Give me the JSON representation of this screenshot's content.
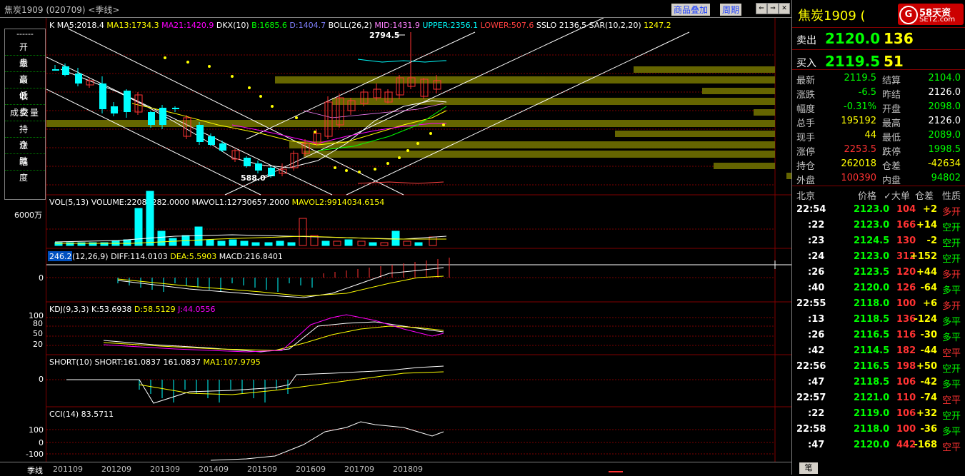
{
  "window": {
    "title": "焦炭1909 (020709) <季线>",
    "links": [
      "商品叠加",
      "周期"
    ],
    "period_label": "季线"
  },
  "leftpanel": {
    "dashes": "------",
    "items": [
      "开盘",
      "最高",
      "最低",
      "收盘",
      "成交量",
      "持仓",
      "涨跌",
      "幅度"
    ]
  },
  "colors": {
    "up": "#ff3232",
    "down": "#00ffff",
    "ma5": "#ffffff",
    "ma13": "#ffff00",
    "ma21": "#ff00ff",
    "grid": "#800000",
    "bid_green": "#00ff00",
    "vol_yellow": "#ffff00"
  },
  "main": {
    "indicator_line": [
      {
        "text": "K",
        "color": "#ffffff"
      },
      {
        "text": "MA5:2018.4",
        "color": "#ffffff"
      },
      {
        "text": "MA13:1734.3",
        "color": "#ffff00"
      },
      {
        "text": "MA21:1420.9",
        "color": "#ff00ff"
      },
      {
        "text": "DKX(10)",
        "color": "#ffffff"
      },
      {
        "text": "B:1685.6",
        "color": "#00ff00"
      },
      {
        "text": "D:1404.7",
        "color": "#8080ff"
      },
      {
        "text": "BOLL(26,2)",
        "color": "#ffffff"
      },
      {
        "text": "MID:1431.9",
        "color": "#ff80ff"
      },
      {
        "text": "UPPER:2356.1",
        "color": "#00ffff"
      },
      {
        "text": "LOWER:507.6",
        "color": "#ff4040"
      },
      {
        "text": "SSLO 2136.5",
        "color": "#ffffff"
      },
      {
        "text": "SAR(10,2,20)",
        "color": "#ffffff"
      },
      {
        "text": "1247.2",
        "color": "#ffff00"
      }
    ],
    "high_label": "2794.5",
    "low_label": "588.0"
  },
  "vol": {
    "indicator_line": [
      {
        "text": "VOL(5,13)",
        "color": "#ffffff"
      },
      {
        "text": "VOLUME:22084282.0000",
        "color": "#ffffff"
      },
      {
        "text": "MAVOL1:12730657.2000",
        "color": "#ffffff"
      },
      {
        "text": "MAVOL2:9914034.6154",
        "color": "#ffff00"
      }
    ],
    "axis_label": "6000万"
  },
  "macd": {
    "badge": "246.2",
    "indicator_line": [
      {
        "text": "(12,26,9)",
        "color": "#ffffff"
      },
      {
        "text": "DIFF:114.0103",
        "color": "#ffffff"
      },
      {
        "text": "DEA:5.5903",
        "color": "#ffff00"
      },
      {
        "text": "MACD:216.8401",
        "color": "#ffffff"
      }
    ],
    "zero_label": "0"
  },
  "kdj": {
    "indicator_line": [
      {
        "text": "KDJ(9,3,3)",
        "color": "#ffffff"
      },
      {
        "text": "K:53.6938",
        "color": "#ffffff"
      },
      {
        "text": "D:58.5129",
        "color": "#ffff00"
      },
      {
        "text": "J:44.0556",
        "color": "#ff00ff"
      }
    ],
    "ticks": [
      "100",
      "80",
      "50",
      "20"
    ]
  },
  "short": {
    "indicator_line": [
      {
        "text": "SHORT(10)",
        "color": "#ffffff"
      },
      {
        "text": "SHORT:161.0837",
        "color": "#ffffff"
      },
      {
        "text": "161.0837",
        "color": "#ffffff"
      },
      {
        "text": "MA1:107.9795",
        "color": "#ffff00"
      }
    ],
    "zero_label": "0"
  },
  "cci": {
    "indicator_line": [
      {
        "text": "CCI(14)",
        "color": "#ffffff"
      },
      {
        "text": "83.5711",
        "color": "#ffffff"
      }
    ],
    "ticks": [
      "100",
      "0",
      "-100"
    ]
  },
  "xaxis": [
    "201109",
    "201209",
    "201309",
    "201409",
    "201509",
    "201609",
    "201709",
    "201809"
  ],
  "right": {
    "name": "焦炭1909 (",
    "logo_line1": "58天资",
    "logo_line2": "SETZ.com",
    "logo_mark": "G",
    "sell_label": "卖出",
    "sell_price": "2120.0",
    "sell_vol": "136",
    "buy_label": "买入",
    "buy_price": "2119.5",
    "buy_vol": "51",
    "stats": [
      {
        "k": "最新",
        "v": "2119.5",
        "c": "#00ff00",
        "k2": "结算",
        "v2": "2104.0",
        "c2": "#00ff00"
      },
      {
        "k": "涨跌",
        "v": "-6.5",
        "c": "#00ff00",
        "k2": "昨结",
        "v2": "2126.0",
        "c2": "#ffffff"
      },
      {
        "k": "幅度",
        "v": "-0.31%",
        "c": "#00ff00",
        "k2": "开盘",
        "v2": "2098.0",
        "c2": "#00ff00"
      },
      {
        "k": "总手",
        "v": "195192",
        "c": "#ffff00",
        "k2": "最高",
        "v2": "2126.0",
        "c2": "#ffffff"
      },
      {
        "k": "现手",
        "v": "44",
        "c": "#ffff00",
        "k2": "最低",
        "v2": "2089.0",
        "c2": "#00ff00"
      },
      {
        "k": "涨停",
        "v": "2253.5",
        "c": "#ff3232",
        "k2": "跌停",
        "v2": "1998.5",
        "c2": "#00ff00"
      },
      {
        "k": "持仓",
        "v": "262018",
        "c": "#ffff00",
        "k2": "仓差",
        "v2": "-42634",
        "c2": "#ffff00"
      },
      {
        "k": "外盘",
        "v": "100390",
        "c": "#ff3232",
        "k2": "内盘",
        "v2": "94802",
        "c2": "#00ff00"
      }
    ],
    "tick_header": [
      "北京",
      "价格",
      "✓大单",
      "仓差",
      "性质"
    ],
    "ticks": [
      {
        "t": "22:54",
        "p": "2123.0",
        "v": "104",
        "d": "+2",
        "n": "多开",
        "main": true
      },
      {
        "t": ":22",
        "p": "2123.0",
        "v": "166",
        "d": "+14",
        "n": "空开",
        "main": false
      },
      {
        "t": ":23",
        "p": "2124.5",
        "v": "130",
        "d": "-2",
        "n": "空开",
        "main": false
      },
      {
        "t": ":24",
        "p": "2123.0",
        "v": "312",
        "d": "+152",
        "n": "空开",
        "main": false
      },
      {
        "t": ":26",
        "p": "2123.5",
        "v": "120",
        "d": "+44",
        "n": "多开",
        "main": false
      },
      {
        "t": ":40",
        "p": "2120.0",
        "v": "126",
        "d": "-64",
        "n": "多平",
        "main": false
      },
      {
        "t": "22:55",
        "p": "2118.0",
        "v": "100",
        "d": "+6",
        "n": "多开",
        "main": true
      },
      {
        "t": ":13",
        "p": "2118.5",
        "v": "136",
        "d": "-124",
        "n": "多平",
        "main": false
      },
      {
        "t": ":26",
        "p": "2116.5",
        "v": "116",
        "d": "-30",
        "n": "多平",
        "main": false
      },
      {
        "t": ":42",
        "p": "2114.5",
        "v": "182",
        "d": "-44",
        "n": "空平",
        "main": false
      },
      {
        "t": "22:56",
        "p": "2116.5",
        "v": "198",
        "d": "+50",
        "n": "空开",
        "main": true
      },
      {
        "t": ":47",
        "p": "2118.5",
        "v": "106",
        "d": "-42",
        "n": "多平",
        "main": false
      },
      {
        "t": "22:57",
        "p": "2121.0",
        "v": "110",
        "d": "-74",
        "n": "空平",
        "main": true
      },
      {
        "t": ":22",
        "p": "2119.0",
        "v": "106",
        "d": "+32",
        "n": "空开",
        "main": false
      },
      {
        "t": "22:58",
        "p": "2118.0",
        "v": "100",
        "d": "-36",
        "n": "多平",
        "main": true
      },
      {
        "t": ":47",
        "p": "2120.0",
        "v": "442",
        "d": "-168",
        "n": "空平",
        "main": false
      }
    ],
    "bottom_tab": "笔"
  }
}
